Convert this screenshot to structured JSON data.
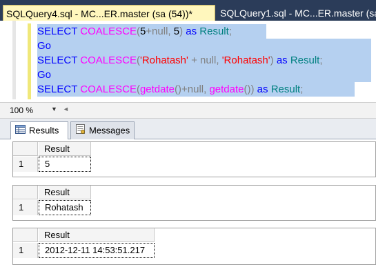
{
  "tabs": {
    "active": "SQLQuery4.sql - MC...ER.master (sa (54))*",
    "inactive": "SQLQuery1.sql - MC...ER.master (sa"
  },
  "editor": {
    "line1": {
      "kw1": "SELECT ",
      "fn": "COALESCE",
      "p1": "(",
      "n1": "5",
      "op": "+null",
      "comma": ", ",
      "n2": "5",
      "p2": ") ",
      "as": "as ",
      "res": "Result",
      "semi": ";"
    },
    "line2": {
      "kw": "Go"
    },
    "line3": {
      "kw1": "SELECT ",
      "fn": "COALESCE",
      "p1": "(",
      "s1": "'Rohatash'",
      "op": " + null, ",
      "s2": "'Rohatash'",
      "p2": ") ",
      "as": "as ",
      "res": "Result",
      "semi": ";"
    },
    "line4": {
      "kw": "Go"
    },
    "line5": {
      "kw1": "SELECT ",
      "fn": "COALESCE",
      "p1": "(",
      "f1": "getdate",
      "pp1": "()",
      "op": "+null, ",
      "f2": "getdate",
      "pp2": "())",
      "as": " as ",
      "res": "Result",
      "semi": ";"
    }
  },
  "zoom": {
    "value": "100 %"
  },
  "result_tabs": {
    "results": "Results",
    "messages": "Messages"
  },
  "results": [
    {
      "column": "Result",
      "row_number": "1",
      "value": "5"
    },
    {
      "column": "Result",
      "row_number": "1",
      "value": "Rohatash"
    },
    {
      "column": "Result",
      "row_number": "1",
      "value": "2012-12-11 14:53:51.217"
    }
  ],
  "colors": {
    "tab_active": "#fff7bd",
    "tab_strip": "#2b3c59",
    "selection": "#b5d0f0",
    "keyword": "#0000ff",
    "function": "#ff00ff",
    "string": "#ff0000",
    "identifier": "#008080"
  },
  "icons": {
    "results": "grid-icon",
    "messages": "messages-icon",
    "zoom_dropdown": "chevron-down-icon",
    "scroll_left": "scroll-left-icon"
  }
}
